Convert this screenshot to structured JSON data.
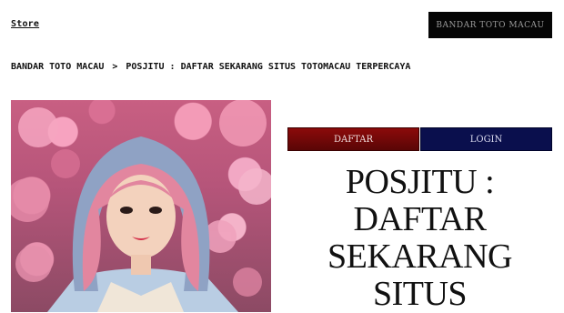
{
  "header": {
    "store_link": "Store",
    "brand_button": "BANDAR TOTO MACAU"
  },
  "breadcrumb": {
    "home": "BANDAR TOTO MACAU",
    "separator": ">",
    "current": "POSJITU : DAFTAR SEKARANG SITUS TOTOMACAU TERPERCAYA"
  },
  "product": {
    "image_alt": "woman with pink hair in front of blossoms",
    "daftar_label": "DAFTAR",
    "login_label": "LOGIN",
    "title": "POSJITU : DAFTAR SEKARANG SITUS"
  },
  "colors": {
    "daftar_bg": "#8b0a0a",
    "login_bg": "#0a0f4d",
    "header_button_bg": "#050505"
  }
}
